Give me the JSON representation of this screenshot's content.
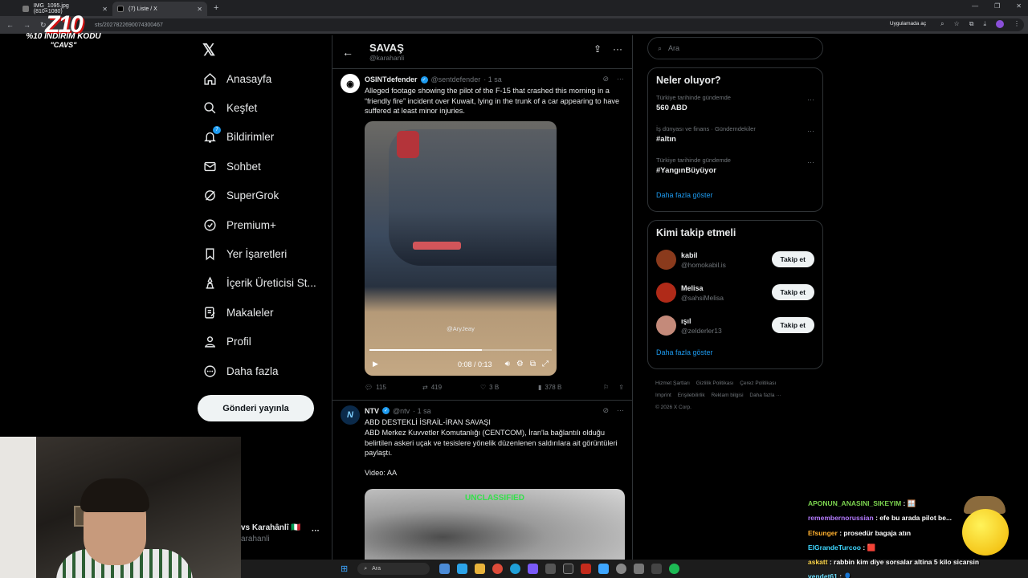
{
  "browser": {
    "tabs": [
      {
        "label": "IMG_1095.jpg (810×1080)",
        "active": false
      },
      {
        "label": "(7) Liste / X",
        "active": true
      }
    ],
    "url": "sts/2027822690074300467",
    "open_in_app": "Uygulamada aç"
  },
  "promo": {
    "logo": "Z10",
    "line1": "%10 İNDİRİM KODU",
    "line2": "\"CAVS\""
  },
  "sidebar": {
    "items": [
      {
        "label": "Anasayfa",
        "icon": "home-icon"
      },
      {
        "label": "Keşfet",
        "icon": "search-icon"
      },
      {
        "label": "Bildirimler",
        "icon": "bell-icon",
        "badge": "7"
      },
      {
        "label": "Sohbet",
        "icon": "mail-icon"
      },
      {
        "label": "SuperGrok",
        "icon": "grok-icon"
      },
      {
        "label": "Premium+",
        "icon": "premium-icon"
      },
      {
        "label": "Yer İşaretleri",
        "icon": "bookmark-icon"
      },
      {
        "label": "İçerik Üreticisi St...",
        "icon": "creator-icon"
      },
      {
        "label": "Makaleler",
        "icon": "articles-icon"
      },
      {
        "label": "Profil",
        "icon": "profile-icon"
      },
      {
        "label": "Daha fazla",
        "icon": "more-icon"
      }
    ],
    "post_button": "Gönderi yayınla",
    "account_name": "vs Karahânlî 🇮🇹",
    "account_handle": "arahanli"
  },
  "list": {
    "title": "SAVAŞ",
    "handle": "@karahanli"
  },
  "tweets": [
    {
      "name": "OSINTdefender",
      "handle": "@sentdefender",
      "time": "· 1 sa",
      "text": "Alleged footage showing the pilot of the F-15 that crashed this morning in a “friendly fire” incident over Kuwait, lying in the trunk of a car appearing to have suffered at least minor injuries.",
      "video": {
        "watermark": "@AryJeay",
        "time": "0:08 / 0:13",
        "progress": 0.615
      },
      "stats": {
        "replies": "115",
        "reposts": "419",
        "likes": "3 B",
        "views": "378 B"
      }
    },
    {
      "name": "NTV",
      "handle": "@ntv",
      "time": "· 1 sa",
      "lines": [
        "ABD DESTEKLİ İSRAİL-İRAN SAVAŞI",
        "ABD Merkez Kuvvetler Komutanlığı (CENTCOM), İran'la bağlantılı olduğu belirtilen askeri uçak ve tesislere yönelik düzenlenen saldırılara ait görüntüleri paylaştı.",
        "Video: AA"
      ],
      "video_label": "UNCLASSIFIED"
    }
  ],
  "right": {
    "search_placeholder": "Ara",
    "trends_title": "Neler oluyor?",
    "trends": [
      {
        "context": "Türkiye tarihinde gündemde",
        "title": "560 ABD"
      },
      {
        "context": "İş dünyası ve finans · Gündemdekiler",
        "title": "#altın"
      },
      {
        "context": "Türkiye tarihinde gündemde",
        "title": "#YangınBüyüyor"
      }
    ],
    "show_more": "Daha fazla göster",
    "who_title": "Kimi takip etmeli",
    "who": [
      {
        "name": "kabil",
        "handle": "@homokabil.is",
        "button": "Takip et",
        "color": "#8a3a1c"
      },
      {
        "name": "Melisa",
        "handle": "@sahsiMelisa",
        "button": "Takip et",
        "color": "#b02a18"
      },
      {
        "name": "ışıl",
        "handle": "@zelderler13",
        "button": "Takip et",
        "color": "#c48a7a"
      }
    ],
    "who_more": "Daha fazla göster",
    "footer": [
      "Hizmet Şartları",
      "Gizlilik Politikası",
      "Çerez Politikası",
      "Imprint",
      "Erişilebilirlik",
      "Reklam bilgisi",
      "Daha fazla ···",
      "© 2026 X Corp."
    ]
  },
  "chat": [
    {
      "user": "APONUN_ANASINI_SIKEYIM",
      "msg": "🪟"
    },
    {
      "user": "remembernorussian",
      "msg": "efe bu arada pilot be..."
    },
    {
      "user": "Efsunger",
      "msg": "prosedür bagaja atın"
    },
    {
      "user": "ElGrandeTurcoo",
      "msg": "🟥"
    },
    {
      "user": "askatt",
      "msg": "rabbin kim diye sorsalar altina 5 kilo sicarsin"
    },
    {
      "user": "vendet61",
      "msg": "👤"
    }
  ],
  "taskbar": {
    "search": "Ara"
  }
}
